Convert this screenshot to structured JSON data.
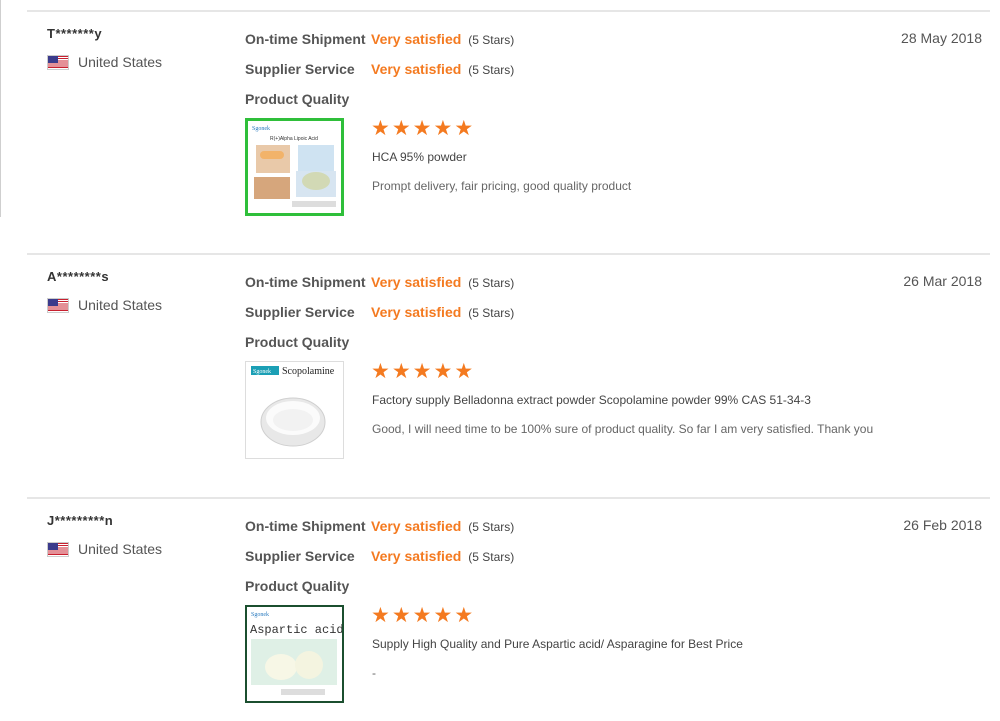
{
  "colors": {
    "accent": "#f47a20",
    "divider": "#e6e6e6"
  },
  "reviews": [
    {
      "buyer": "T*******y",
      "country": "United States",
      "flag_icon": "us-flag-icon",
      "date": "28 May 2018",
      "ratings": [
        {
          "label": "On-time Shipment",
          "value": "Very satisfied",
          "stars_text": "(5 Stars)"
        },
        {
          "label": "Supplier Service",
          "value": "Very satisfied",
          "stars_text": "(5 Stars)"
        }
      ],
      "product_quality_label": "Product Quality",
      "star_rating": 5,
      "product_name": "HCA 95% powder",
      "text": "Prompt delivery, fair pricing, good quality product",
      "thumb": {
        "brand": "Sgonek",
        "title": "R(+)Alpha Lipoic Acid"
      }
    },
    {
      "buyer": "A********s",
      "country": "United States",
      "flag_icon": "us-flag-icon",
      "date": "26 Mar 2018",
      "ratings": [
        {
          "label": "On-time Shipment",
          "value": "Very satisfied",
          "stars_text": "(5 Stars)"
        },
        {
          "label": "Supplier Service",
          "value": "Very satisfied",
          "stars_text": "(5 Stars)"
        }
      ],
      "product_quality_label": "Product Quality",
      "star_rating": 5,
      "product_name": "Factory supply Belladonna extract powder Scopolamine powder 99% CAS 51-34-3",
      "text": "Good, I will need time to be 100% sure of product quality. So far I am very satisfied. Thank you",
      "thumb": {
        "brand": "Sgonek",
        "title": "Scopolamine"
      }
    },
    {
      "buyer": "J*********n",
      "country": "United States",
      "flag_icon": "us-flag-icon",
      "date": "26 Feb 2018",
      "ratings": [
        {
          "label": "On-time Shipment",
          "value": "Very satisfied",
          "stars_text": "(5 Stars)"
        },
        {
          "label": "Supplier Service",
          "value": "Very satisfied",
          "stars_text": "(5 Stars)"
        }
      ],
      "product_quality_label": "Product Quality",
      "star_rating": 5,
      "product_name": "Supply High Quality and Pure Aspartic acid/ Asparagine for Best Price",
      "text": "-",
      "thumb": {
        "brand": "Sgonek",
        "title": "Aspartic acid"
      }
    }
  ]
}
